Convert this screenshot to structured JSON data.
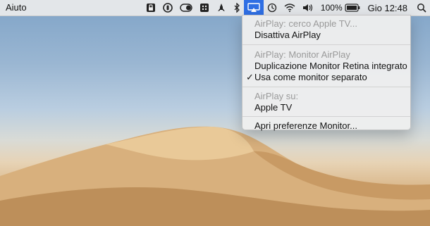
{
  "menubar": {
    "app_menu_label": "Aiuto",
    "status_icons": [
      "lock-icon",
      "circle-icon",
      "toggle-icon",
      "grid-icon",
      "rocket-icon",
      "bluetooth-icon",
      "airplay-icon",
      "time-machine-icon",
      "wifi-icon",
      "volume-icon",
      "battery-icon",
      "search-icon"
    ],
    "battery_percent": "100%",
    "clock": "Gio 12:48"
  },
  "airplay_menu": {
    "header_searching": "AirPlay: cerco Apple TV...",
    "disable_airplay": "Disattiva AirPlay",
    "header_monitor": "AirPlay: Monitor AirPlay",
    "mirror_display": "Duplicazione Monitor Retina integrato",
    "separate_display": "Usa come monitor separato",
    "separate_display_checked": true,
    "header_to": "AirPlay su:",
    "apple_tv": "Apple TV",
    "open_prefs": "Apri preferenze Monitor..."
  },
  "colors": {
    "accent": "#2f6fe4",
    "header_text": "#9a9a9a"
  }
}
